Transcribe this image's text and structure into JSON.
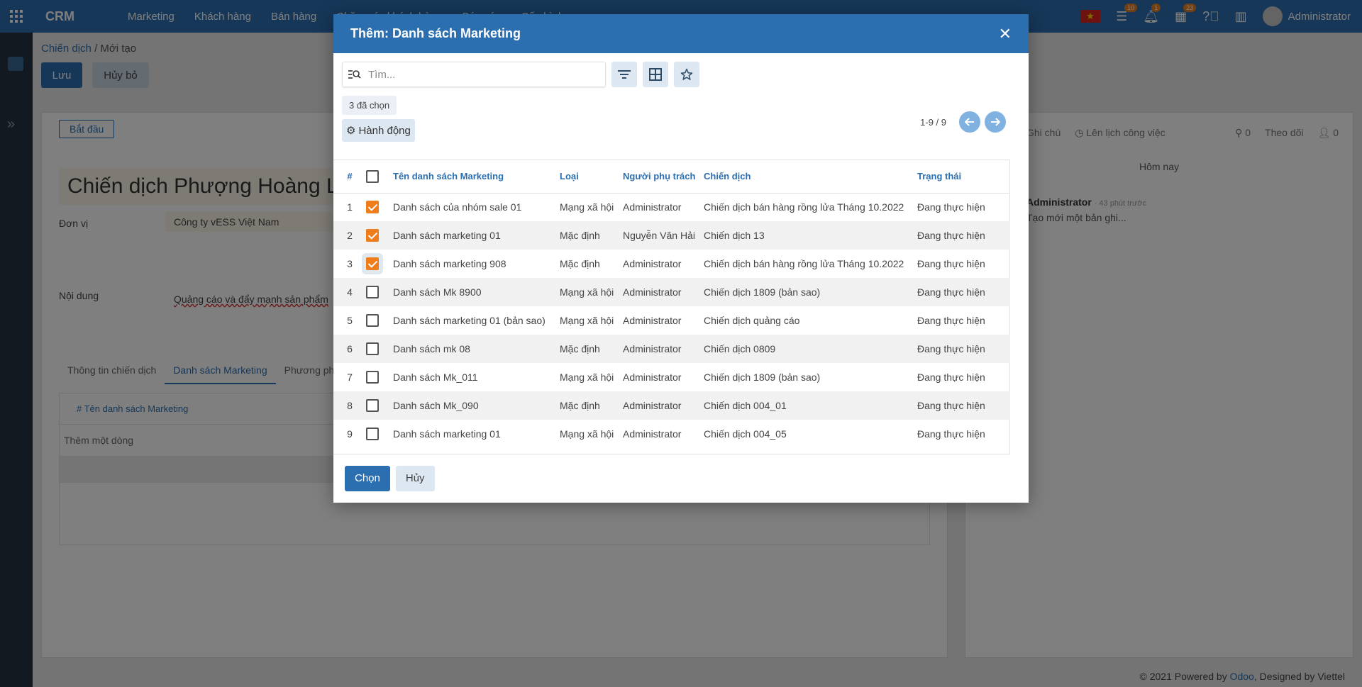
{
  "topbar": {
    "brand": "CRM",
    "menu": [
      "Marketing",
      "Khách hàng",
      "Bán hàng",
      "Chăm sóc khách hàng",
      "Báo cáo",
      "Cấu hình"
    ],
    "badges": {
      "activities": "10",
      "notifications": "1",
      "calendar": "23"
    },
    "user": "Administrator"
  },
  "breadcrumb": {
    "parent": "Chiến dịch",
    "current": "Mới tạo"
  },
  "form": {
    "save_label": "Lưu",
    "discard_label": "Hủy bỏ",
    "status_button": "Bắt đầu",
    "title": "Chiến dịch Phượng Hoàng Lửa",
    "unit_label": "Đơn vị",
    "unit_value": "Công ty vESS Việt Nam",
    "content_label": "Nội dung",
    "content_value": "Quảng cáo và đẩy mạnh sản phẩm",
    "tabs": [
      "Thông tin chiến dịch",
      "Danh sách Marketing",
      "Phương pháp"
    ],
    "subtable_header": "#   Tên danh sách Marketing",
    "add_line": "Thêm một dòng"
  },
  "chatter": {
    "note": "Ghi chú",
    "schedule": "Lên lịch công việc",
    "attachments": "0",
    "follow": "Theo dõi",
    "followers": "0",
    "today": "Hôm nay",
    "author": "Administrator",
    "time": "· 43 phút trước",
    "message": "Tạo mới một bản ghi..."
  },
  "footer": {
    "prefix": "© 2021 Powered by ",
    "odoo": "Odoo",
    "suffix": ", Designed by Viettel"
  },
  "modal": {
    "title": "Thêm: Danh sách Marketing",
    "search_placeholder": "Tìm...",
    "selected_count": "3 đã chọn",
    "action_label": "Hành động",
    "pager": "1-9 / 9",
    "columns": {
      "num": "#",
      "name": "Tên danh sách Marketing",
      "type": "Loại",
      "owner": "Người phụ trách",
      "campaign": "Chiến dịch",
      "state": "Trạng thái"
    },
    "rows": [
      {
        "num": "1",
        "checked": true,
        "name": "Danh sách của nhóm sale 01",
        "type": "Mạng xã hội",
        "owner": "Administrator",
        "campaign": "Chiến dịch bán hàng rồng lửa Tháng 10.2022",
        "state": "Đang thực hiện"
      },
      {
        "num": "2",
        "checked": true,
        "name": "Danh sách marketing 01",
        "type": "Mặc định",
        "owner": "Nguyễn Văn Hải",
        "campaign": "Chiến dịch 13",
        "state": "Đang thực hiện"
      },
      {
        "num": "3",
        "checked": true,
        "name": "Danh sách marketing 908",
        "type": "Mặc định",
        "owner": "Administrator",
        "campaign": "Chiến dịch bán hàng rồng lửa Tháng 10.2022",
        "state": "Đang thực hiện"
      },
      {
        "num": "4",
        "checked": false,
        "name": "Danh sách Mk 8900",
        "type": "Mạng xã hội",
        "owner": "Administrator",
        "campaign": "Chiến dịch 1809 (bản sao)",
        "state": "Đang thực hiện"
      },
      {
        "num": "5",
        "checked": false,
        "name": "Danh sách marketing 01 (bản sao)",
        "type": "Mạng xã hội",
        "owner": "Administrator",
        "campaign": "Chiến dịch quảng cáo",
        "state": "Đang thực hiện"
      },
      {
        "num": "6",
        "checked": false,
        "name": "Danh sách mk 08",
        "type": "Mặc định",
        "owner": "Administrator",
        "campaign": "Chiến dịch 0809",
        "state": "Đang thực hiện"
      },
      {
        "num": "7",
        "checked": false,
        "name": "Danh sách Mk_011",
        "type": "Mạng xã hội",
        "owner": "Administrator",
        "campaign": "Chiến dịch 1809 (bản sao)",
        "state": "Đang thực hiện"
      },
      {
        "num": "8",
        "checked": false,
        "name": "Danh sách Mk_090",
        "type": "Mặc định",
        "owner": "Administrator",
        "campaign": "Chiến dịch 004_01",
        "state": "Đang thực hiện"
      },
      {
        "num": "9",
        "checked": false,
        "name": "Danh sách marketing 01",
        "type": "Mạng xã hội",
        "owner": "Administrator",
        "campaign": "Chiến dịch 004_05",
        "state": "Đang thực hiện"
      }
    ],
    "select_label": "Chọn",
    "cancel_label": "Hủy"
  },
  "colors": {
    "primary": "#2c6fb0",
    "checkbox": "#f07c1a"
  }
}
